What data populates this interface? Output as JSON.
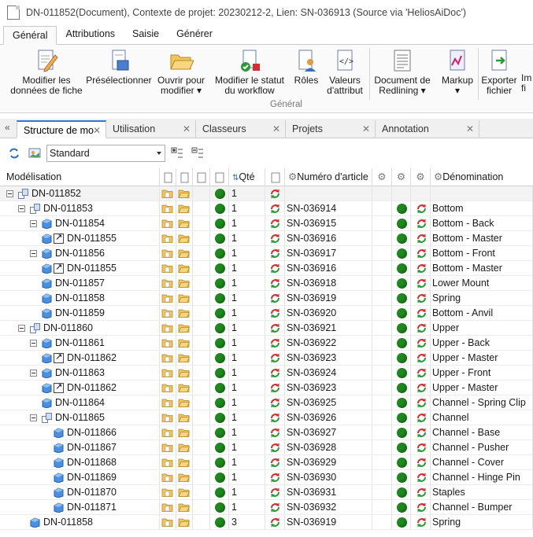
{
  "window": {
    "title": "DN-011852(Document), Contexte de projet: 20230212-2, Lien: SN-036913  (Source via 'HeliosAiDoc')"
  },
  "ribbon_tabs": [
    "Général",
    "Attributions",
    "Saisie",
    "Générer"
  ],
  "ribbon": {
    "group_label": "Général",
    "buttons": [
      {
        "l1": "Modifier les",
        "l2": "données de fiche",
        "icon": "edit-document-icon"
      },
      {
        "l1": "Présélectionner",
        "l2": "",
        "icon": "preselect-icon"
      },
      {
        "l1": "Ouvrir pour",
        "l2": "modifier ▾",
        "icon": "open-folder-icon"
      },
      {
        "l1": "Modifier le statut",
        "l2": "du workflow",
        "icon": "workflow-status-icon"
      },
      {
        "l1": "Rôles",
        "l2": "",
        "icon": "roles-icon"
      },
      {
        "l1": "Valeurs",
        "l2": "d'attribut",
        "icon": "attribute-values-icon"
      },
      {
        "l1": "Document de",
        "l2": "Redlining ▾",
        "icon": "redlining-icon"
      },
      {
        "l1": "Markup",
        "l2": "▾",
        "icon": "markup-icon"
      },
      {
        "l1": "Exporter",
        "l2": "fichier",
        "icon": "export-icon"
      },
      {
        "l1": "Im",
        "l2": "fi",
        "icon": "import-icon"
      }
    ]
  },
  "panel_tabs": [
    "Structure de mo",
    "Utilisation",
    "Classeurs",
    "Projets",
    "Annotation"
  ],
  "toolbar": {
    "view_select": "Standard"
  },
  "columns": {
    "modelisation": "Modélisation",
    "qte": "Qté",
    "numero_article": "Numéro d'article",
    "denomination": "Dénomination"
  },
  "rows": [
    {
      "level": 0,
      "kind": "asm",
      "exp": true,
      "dn": "DN-011852",
      "qty": "1",
      "sn": "",
      "name": ""
    },
    {
      "level": 1,
      "kind": "asm",
      "exp": true,
      "dn": "DN-011853",
      "qty": "1",
      "sn": "SN-036914",
      "name": "Bottom"
    },
    {
      "level": 2,
      "kind": "part",
      "exp": true,
      "dn": "DN-011854",
      "qty": "1",
      "sn": "SN-036915",
      "name": "Bottom - Back"
    },
    {
      "level": 3,
      "kind": "link",
      "exp": false,
      "dn": "DN-011855",
      "qty": "1",
      "sn": "SN-036916",
      "name": "Bottom - Master"
    },
    {
      "level": 2,
      "kind": "part",
      "exp": true,
      "dn": "DN-011856",
      "qty": "1",
      "sn": "SN-036917",
      "name": "Bottom - Front"
    },
    {
      "level": 3,
      "kind": "link",
      "exp": false,
      "dn": "DN-011855",
      "qty": "1",
      "sn": "SN-036916",
      "name": "Bottom - Master"
    },
    {
      "level": 2,
      "kind": "part",
      "exp": false,
      "dn": "DN-011857",
      "qty": "1",
      "sn": "SN-036918",
      "name": "Lower Mount"
    },
    {
      "level": 2,
      "kind": "part",
      "exp": false,
      "dn": "DN-011858",
      "qty": "1",
      "sn": "SN-036919",
      "name": "Spring"
    },
    {
      "level": 2,
      "kind": "part",
      "exp": false,
      "dn": "DN-011859",
      "qty": "1",
      "sn": "SN-036920",
      "name": "Bottom - Anvil"
    },
    {
      "level": 1,
      "kind": "asm",
      "exp": true,
      "dn": "DN-011860",
      "qty": "1",
      "sn": "SN-036921",
      "name": "Upper"
    },
    {
      "level": 2,
      "kind": "part",
      "exp": true,
      "dn": "DN-011861",
      "qty": "1",
      "sn": "SN-036922",
      "name": "Upper - Back"
    },
    {
      "level": 3,
      "kind": "link",
      "exp": false,
      "dn": "DN-011862",
      "qty": "1",
      "sn": "SN-036923",
      "name": "Upper - Master"
    },
    {
      "level": 2,
      "kind": "part",
      "exp": true,
      "dn": "DN-011863",
      "qty": "1",
      "sn": "SN-036924",
      "name": "Upper - Front"
    },
    {
      "level": 3,
      "kind": "link",
      "exp": false,
      "dn": "DN-011862",
      "qty": "1",
      "sn": "SN-036923",
      "name": "Upper - Master"
    },
    {
      "level": 2,
      "kind": "part",
      "exp": false,
      "dn": "DN-011864",
      "qty": "1",
      "sn": "SN-036925",
      "name": "Channel - Spring Clip"
    },
    {
      "level": 2,
      "kind": "asm",
      "exp": true,
      "dn": "DN-011865",
      "qty": "1",
      "sn": "SN-036926",
      "name": "Channel"
    },
    {
      "level": 3,
      "kind": "part",
      "exp": false,
      "dn": "DN-011866",
      "qty": "1",
      "sn": "SN-036927",
      "name": "Channel - Base"
    },
    {
      "level": 3,
      "kind": "part",
      "exp": false,
      "dn": "DN-011867",
      "qty": "1",
      "sn": "SN-036928",
      "name": "Channel - Pusher"
    },
    {
      "level": 3,
      "kind": "part",
      "exp": false,
      "dn": "DN-011868",
      "qty": "1",
      "sn": "SN-036929",
      "name": "Channel - Cover"
    },
    {
      "level": 3,
      "kind": "part",
      "exp": false,
      "dn": "DN-011869",
      "qty": "1",
      "sn": "SN-036930",
      "name": "Channel - Hinge Pin"
    },
    {
      "level": 3,
      "kind": "part",
      "exp": false,
      "dn": "DN-011870",
      "qty": "1",
      "sn": "SN-036931",
      "name": "Staples"
    },
    {
      "level": 3,
      "kind": "part",
      "exp": false,
      "dn": "DN-011871",
      "qty": "1",
      "sn": "SN-036932",
      "name": "Channel - Bumper"
    },
    {
      "level": 1,
      "kind": "part",
      "exp": false,
      "dn": "DN-011858",
      "qty": "3",
      "sn": "SN-036919",
      "name": "Spring"
    }
  ],
  "colors": {
    "status_green": "#1e8a1e",
    "accent_tab": "#2b79d0",
    "folder": "#f2c55c"
  }
}
